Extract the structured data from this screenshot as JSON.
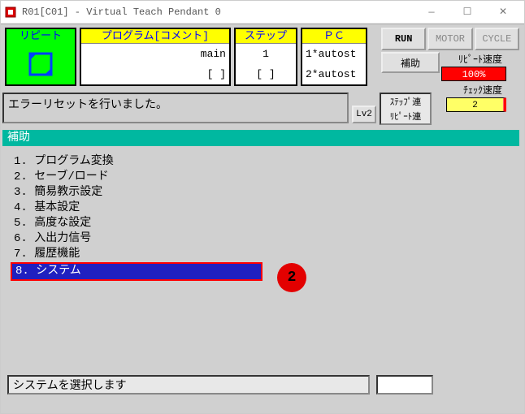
{
  "title": "R01[C01] - Virtual Teach Pendant 0",
  "top": {
    "repeat_label": "リピート",
    "program_header": "プログラム[コメント]",
    "program_lines": [
      "main",
      "[                    ]"
    ],
    "step_header": "ステップ",
    "step_lines": [
      "1",
      "[         ]"
    ],
    "pc_header": "ＰＣ",
    "pc_lines": [
      "1*autost",
      "2*autost"
    ]
  },
  "right": {
    "run": "RUN",
    "motor": "MOTOR",
    "cycle": "CYCLE",
    "aux": "補助",
    "repeat_speed_label": "ﾘﾋﾟｰﾄ速度",
    "repeat_speed_val": "100%",
    "check_speed_label": "ﾁｪｯｸ速度",
    "check_speed_val": "2"
  },
  "message": "エラーリセットを行いました。",
  "lv": "Lv2",
  "step_link": [
    "ｽﾃｯﾌﾟ連",
    "ﾘﾋﾟｰﾄ連"
  ],
  "help_title": " 補助",
  "menu": [
    "1.  プログラム変換",
    "2.  セーブ/ロード",
    "3.  簡易教示設定",
    "4.  基本設定",
    "5.  高度な設定",
    "6.  入出力信号",
    "7.  履歴機能",
    "8.  システム"
  ],
  "menu_selected_index": 7,
  "annotation": "2",
  "status": "システムを選択します"
}
